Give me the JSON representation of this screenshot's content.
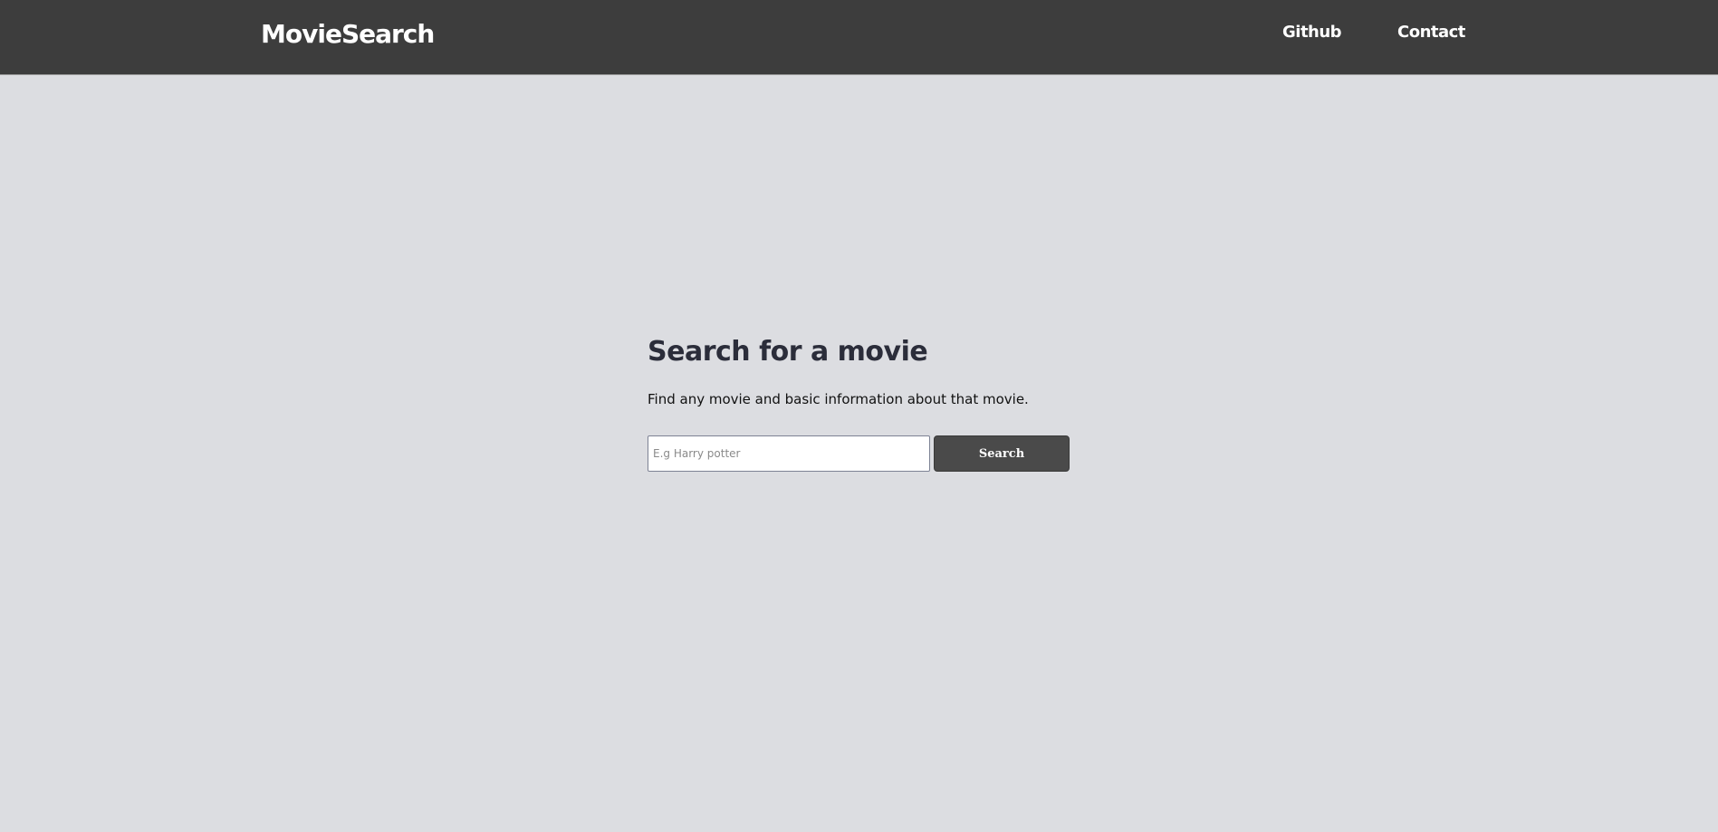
{
  "navbar": {
    "brand": "MovieSearch",
    "links": [
      {
        "label": "Github"
      },
      {
        "label": "Contact"
      }
    ]
  },
  "hero": {
    "title": "Search for a movie",
    "subtitle": "Find any movie and basic information about that movie.",
    "search": {
      "placeholder": "E.g Harry potter",
      "value": "",
      "button_label": "Search"
    }
  },
  "colors": {
    "navbar_bg": "#3d3d3d",
    "page_bg": "#dcdde1",
    "button_bg": "#4a4a4a",
    "title_text": "#2b2d3a"
  }
}
